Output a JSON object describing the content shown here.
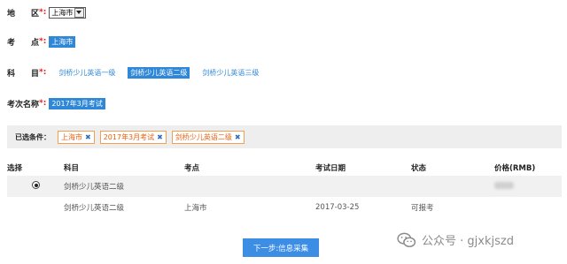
{
  "form": {
    "region": {
      "label": "地　　区",
      "req": "*:",
      "value": "上海市"
    },
    "center": {
      "label": "考　　点",
      "req": "*:",
      "value": "上海市"
    },
    "subject": {
      "label": "科　　目",
      "req": "*:",
      "options": [
        "剑桥少儿英语一级",
        "剑桥少儿英语二级",
        "剑桥少儿英语三级"
      ],
      "active_index": 1
    },
    "session": {
      "label": "考次名称",
      "req": "*:",
      "value": "2017年3月考试"
    }
  },
  "conditions": {
    "label": "已选条件：",
    "tags": [
      "上海市",
      "2017年3月考试",
      "剑桥少儿英语二级"
    ],
    "remove_glyph": "✖"
  },
  "table": {
    "headers": [
      "选择",
      "科目",
      "考点",
      "考试日期",
      "状态",
      "价格(RMB)"
    ],
    "rows": [
      {
        "subject": "剑桥少儿英语二级",
        "center": "",
        "date": "",
        "status": ""
      },
      {
        "subject": "剑桥少儿英语二级",
        "center": "上海市",
        "date": "2017-03-25",
        "status": "可报考"
      }
    ]
  },
  "next_button": "下一步:信息采集",
  "watermark": {
    "text": "公众号 · gjxkjszd",
    "icon": "wechat-icon"
  },
  "colors": {
    "accent": "#2f87d8",
    "required": "#e02020",
    "tag_border": "#f0a050",
    "tag_text": "#e86010"
  }
}
